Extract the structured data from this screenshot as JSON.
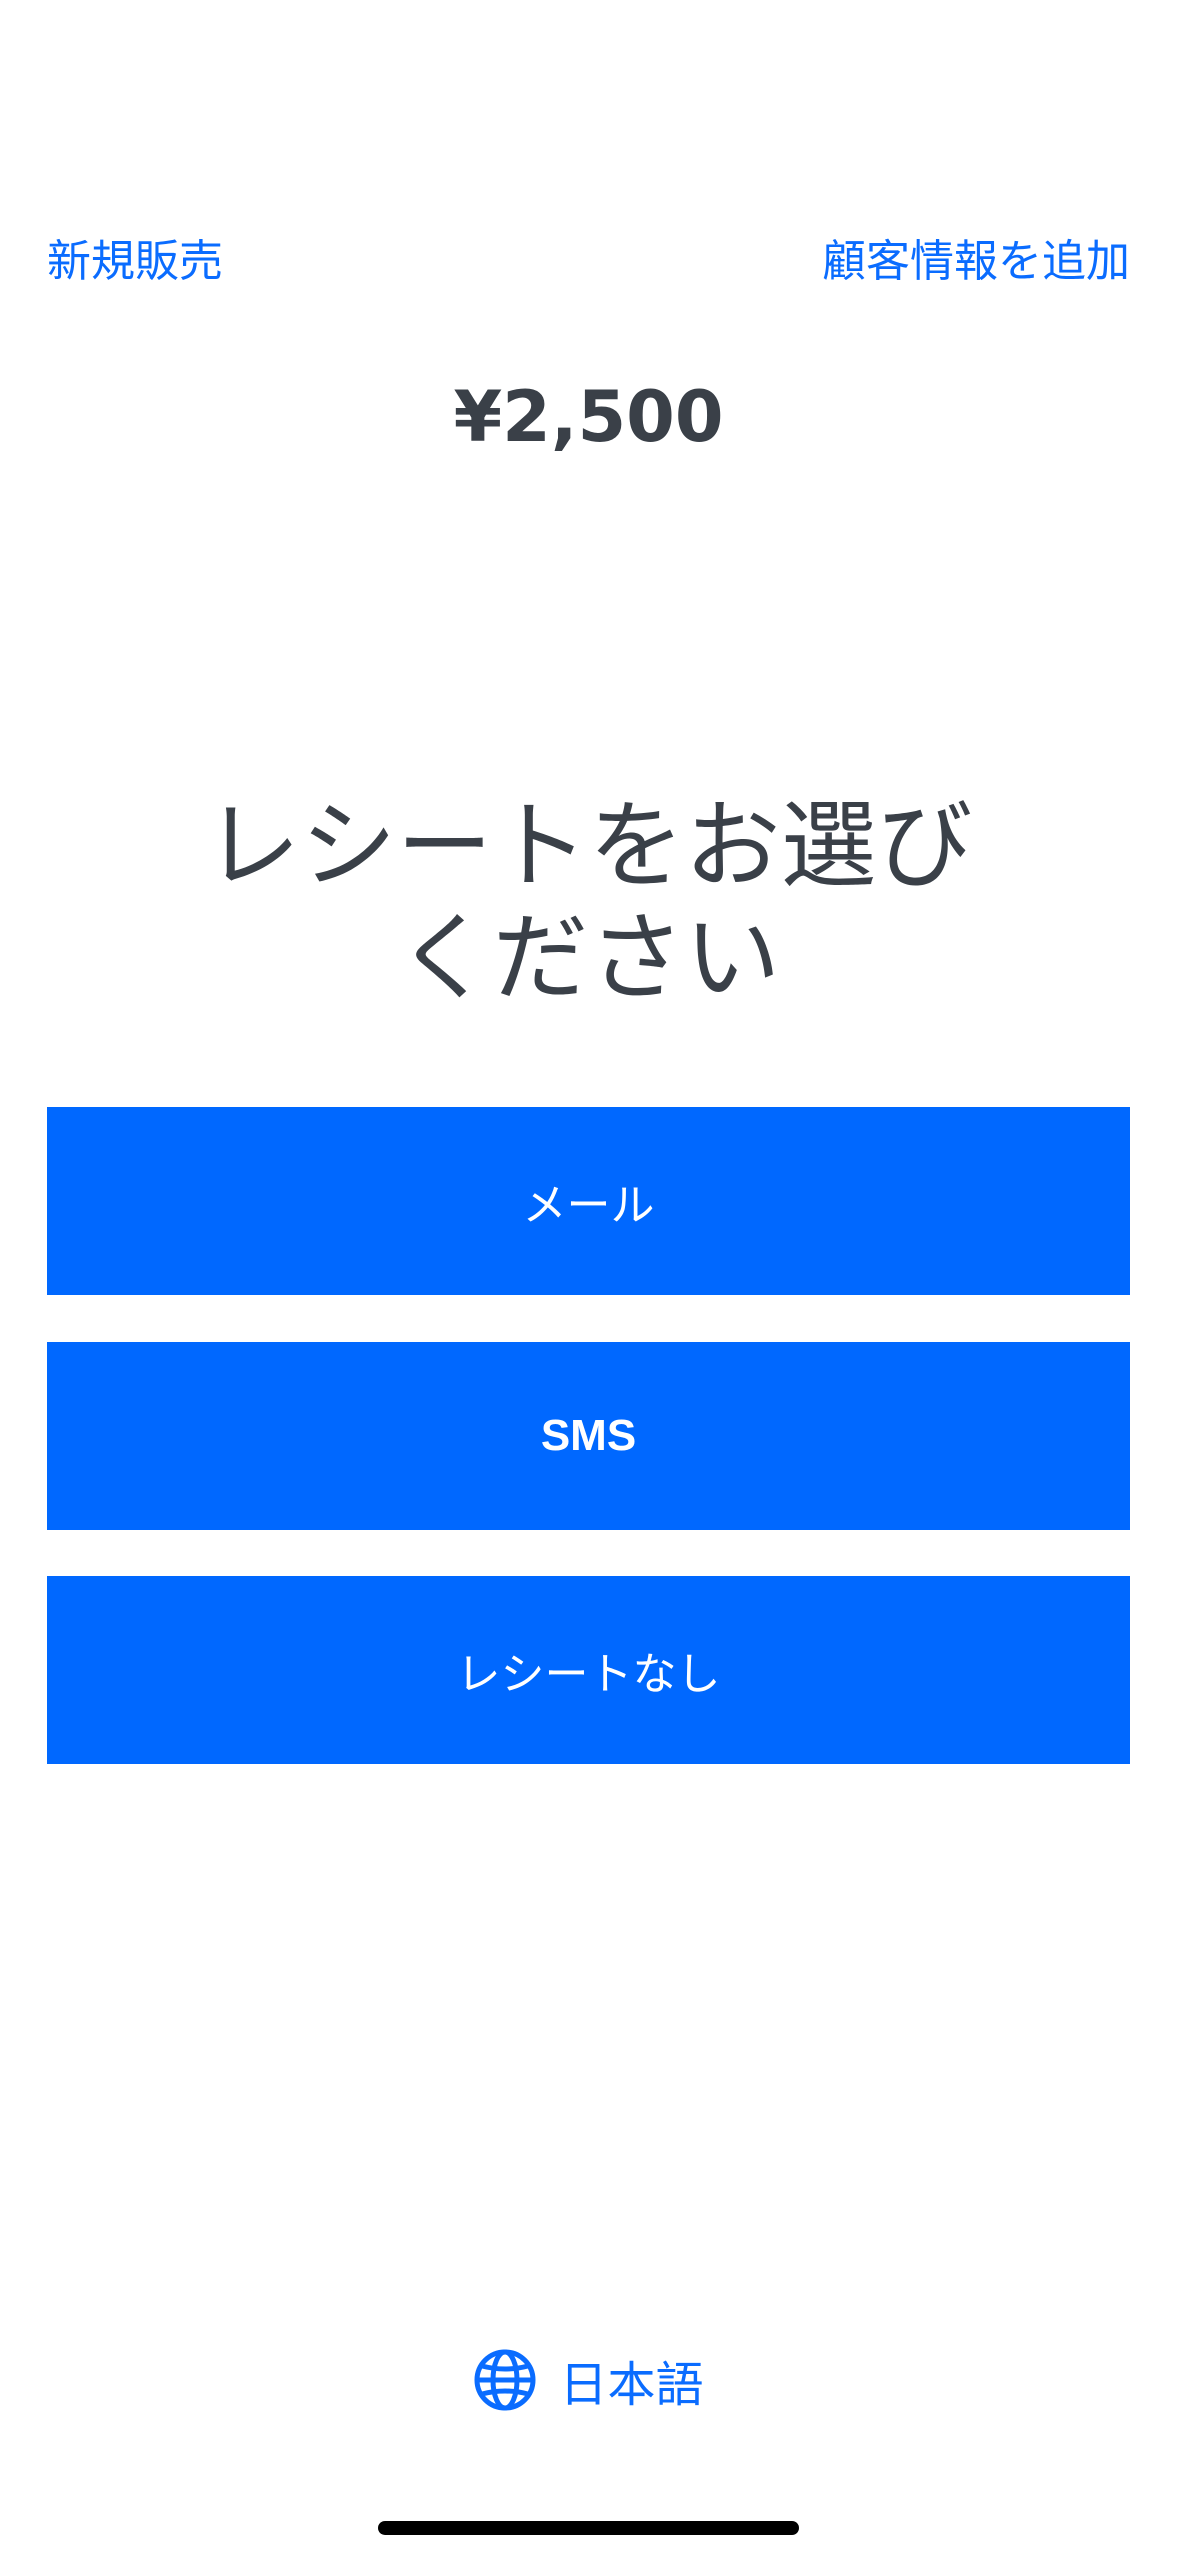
{
  "header": {
    "new_sale_label": "新規販売",
    "add_customer_label": "顧客情報を追加"
  },
  "amount": "¥2,500",
  "heading": {
    "line1": "レシートをお選び",
    "line2": "ください"
  },
  "buttons": {
    "email_label": "メール",
    "sms_label": "SMS",
    "no_receipt_label": "レシートなし"
  },
  "language": {
    "label": "日本語",
    "icon": "globe-icon"
  },
  "colors": {
    "accent": "#0068ff",
    "text": "#3a4048",
    "link": "#0a6cff"
  }
}
